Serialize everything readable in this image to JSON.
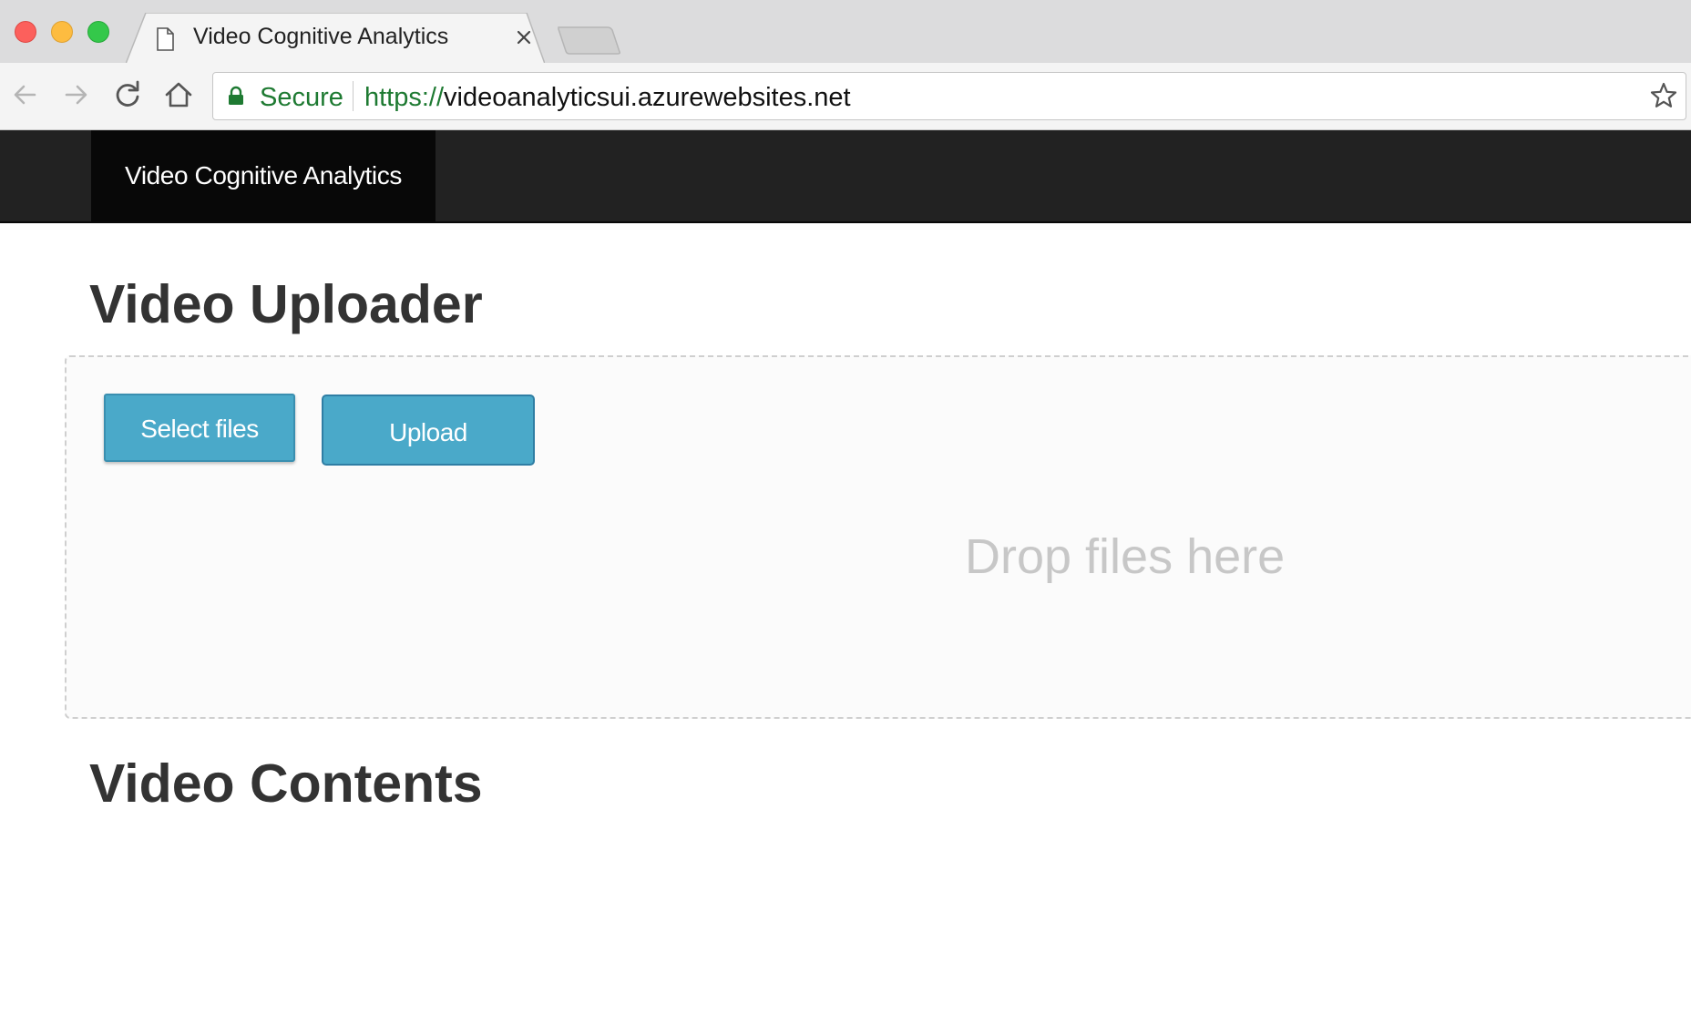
{
  "browser": {
    "tab": {
      "title": "Video Cognitive Analytics"
    },
    "address_bar": {
      "secure_label": "Secure",
      "url_scheme": "https://",
      "url_host": "videoanalyticsui.azurewebsites.net"
    },
    "icons": [
      "back-arrow-icon",
      "forward-arrow-icon",
      "reload-icon",
      "home-icon",
      "lock-icon",
      "star-icon",
      "document-icon",
      "close-icon"
    ]
  },
  "navbar": {
    "brand": "Video Cognitive Analytics"
  },
  "uploader": {
    "heading": "Video Uploader",
    "select_button": "Select files",
    "upload_button": "Upload",
    "drop_hint": "Drop files here"
  },
  "contents": {
    "heading": "Video Contents"
  },
  "colors": {
    "navbar_bg": "#222222",
    "brand_bg": "#080808",
    "button_bg": "#4aa9c9",
    "secure_green": "#1e7a32",
    "heading_text": "#333333"
  }
}
